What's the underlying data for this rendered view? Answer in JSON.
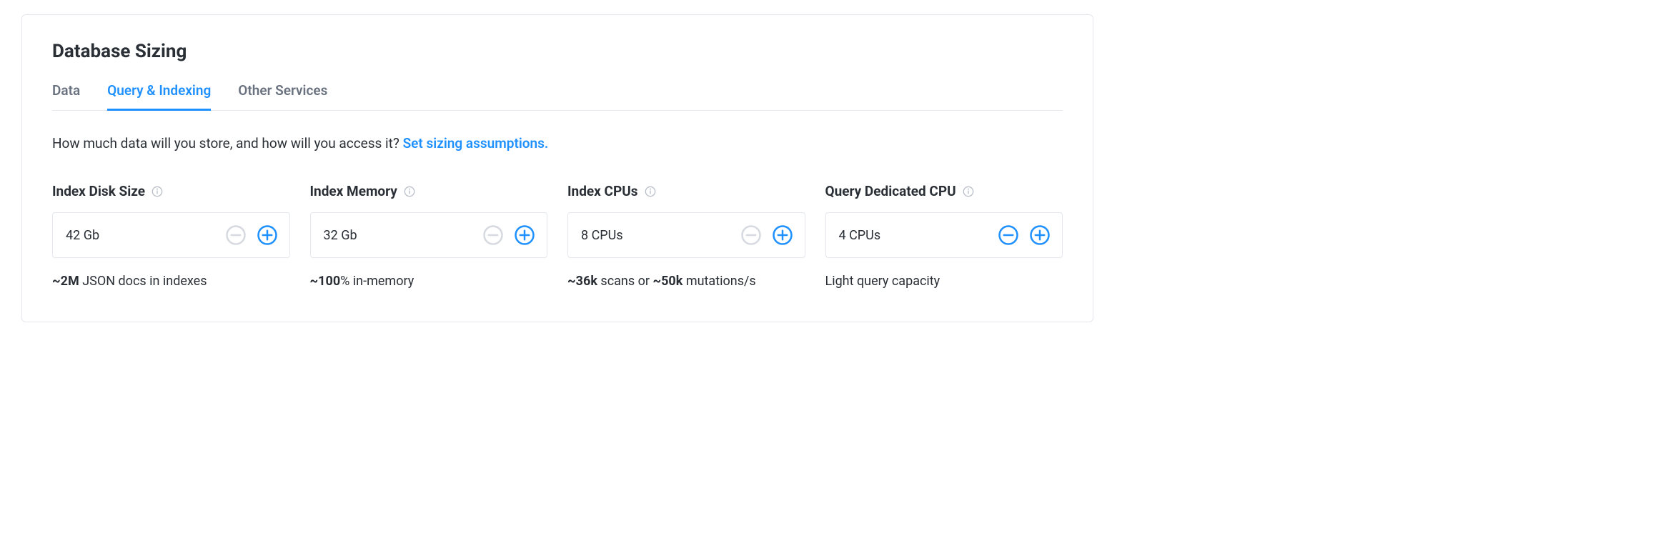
{
  "card": {
    "title": "Database Sizing"
  },
  "tabs": [
    {
      "label": "Data",
      "active": false
    },
    {
      "label": "Query & Indexing",
      "active": true
    },
    {
      "label": "Other Services",
      "active": false
    }
  ],
  "prompt": {
    "text": "How much data will you store, and how will you access it? ",
    "link": "Set sizing assumptions."
  },
  "metrics": [
    {
      "key": "index-disk-size",
      "label": "Index Disk Size",
      "value": "42 Gb",
      "minus_enabled": false,
      "plus_enabled": true,
      "note_parts": [
        {
          "bold": true,
          "text": "~2M"
        },
        {
          "bold": false,
          "text": " JSON docs in indexes"
        }
      ]
    },
    {
      "key": "index-memory",
      "label": "Index Memory",
      "value": "32 Gb",
      "minus_enabled": false,
      "plus_enabled": true,
      "note_parts": [
        {
          "bold": true,
          "text": "~100"
        },
        {
          "bold": false,
          "text": "% in-memory"
        }
      ]
    },
    {
      "key": "index-cpus",
      "label": "Index CPUs",
      "value": "8 CPUs",
      "minus_enabled": false,
      "plus_enabled": true,
      "note_parts": [
        {
          "bold": true,
          "text": "~36k"
        },
        {
          "bold": false,
          "text": " scans or "
        },
        {
          "bold": true,
          "text": "~50k"
        },
        {
          "bold": false,
          "text": " mutations/s"
        }
      ]
    },
    {
      "key": "query-dedicated-cpu",
      "label": "Query Dedicated CPU",
      "value": "4 CPUs",
      "minus_enabled": true,
      "plus_enabled": true,
      "note_parts": [
        {
          "bold": false,
          "text": "Light query capacity"
        }
      ]
    }
  ],
  "colors": {
    "active": "#1e90ff",
    "disabled": "#d6dae0"
  }
}
